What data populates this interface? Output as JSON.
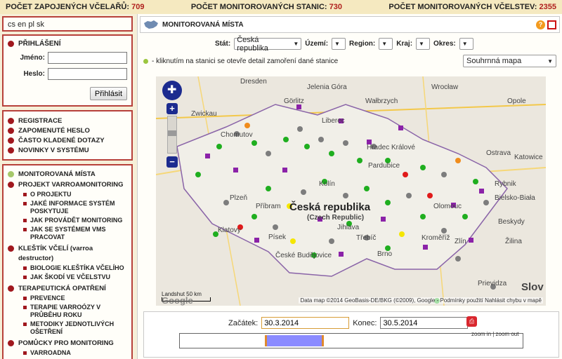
{
  "stats": [
    {
      "label": "POČET ZAPOJENÝCH VČELAŘŮ:",
      "value": "709"
    },
    {
      "label": "POČET MONITOROVANÝCH STANIC:",
      "value": "730"
    },
    {
      "label": "POČET MONITOROVANÝCH VČELSTEV:",
      "value": "2355"
    }
  ],
  "languages": "cs en pl sk",
  "login": {
    "title": "PŘIHLÁŠENÍ",
    "name_label": "Jméno:",
    "password_label": "Heslo:",
    "name_value": "",
    "password_value": "",
    "submit": "Přihlásit"
  },
  "links": [
    "REGISTRACE",
    "ZAPOMENUTÉ HESLO",
    "ČASTO KLADENÉ DOTAZY",
    "NOVINKY V SYSTÉMU"
  ],
  "nav": {
    "monitorovana": "MONITOROVANÁ MÍSTA",
    "projekt": "PROJEKT VARROAMONITORING",
    "projekt_subs": [
      "O PROJEKTU",
      "JAKÉ INFORMACE SYSTÉM POSKYTUJE",
      "JAK PROVÁDĚT MONITORING",
      "JAK SE SYSTÉMEM VMS PRACOVAT"
    ],
    "kleste_caps": "KLEŠTÍK VČELÍ",
    "kleste_rest": " (varroa destructor)",
    "kleste_subs": [
      "BIOLOGIE KLEŠTÍKA VČELÍHO",
      "JAK ŠKODÍ VE VČELSTVU"
    ],
    "terapie": "TERAPEUTICKÁ OPATŘENÍ",
    "terapie_subs": [
      "PREVENCE",
      "TERAPIE VARROÓZY V PRŮBĚHU ROKU",
      "METODIKY JEDNOTLIVÝCH OŠETŘENÍ"
    ],
    "pomucky": "POMŮCKY PRO MONITORING",
    "pomucky_subs": [
      "VARROADNA"
    ]
  },
  "main": {
    "title": "MONITOROVANÁ MÍSTA",
    "help_icon": "?",
    "filters": {
      "stat_label": "Stát:",
      "stat_value": "Česká republika",
      "uzemi_label": "Území:",
      "region_label": "Region:",
      "kraj_label": "Kraj:",
      "okres_label": "Okres:"
    },
    "note": "- kliknutím na stanici se otevře detail zamoření dané stanice",
    "map_type": "Souhrnná mapa"
  },
  "map": {
    "country_label": "Česká republika",
    "country_sub": "(Czech Republic)",
    "cities": [
      "Dresden",
      "Jelenia Góra",
      "Wrocław",
      "Görlitz",
      "Wałbrzych",
      "Opole",
      "Zwickau",
      "Chomutov",
      "Liberec",
      "Hradec Králové",
      "Pardubice",
      "Ostrava",
      "Katowice",
      "Plzeň",
      "Příbram",
      "Kolín",
      "Jihlava",
      "Olomouc",
      "Rybnik",
      "Bielsko-Biała",
      "Klatovy",
      "Písek",
      "Třebíč",
      "Brno",
      "Kroměříž",
      "Zlín",
      "Žilina",
      "České Budějovice",
      "Prievidza",
      "Beskydy",
      "Slov"
    ],
    "attribution": "Data map ©2014 GeoBasis-DE/BKG (©2009), Google - Podmínky použití   Nahlásit chybu v mapě",
    "scale_label": "Landshut 50 km",
    "logo": "Google"
  },
  "timeline": {
    "start_label": "Začátek:",
    "start_value": "30.3.2014",
    "end_label": "Konec:",
    "end_value": "30.5.2014",
    "zoom": "zoom in | zoom out"
  },
  "colors": {
    "accent": "#b7403a",
    "top_value": "#b0201e",
    "station_green": "#1fae1f",
    "station_grey": "#7d7d7d",
    "station_purple": "#8b22a8",
    "station_red": "#e01a1a",
    "station_yellow": "#f5e600",
    "station_orange": "#f08c1c"
  }
}
